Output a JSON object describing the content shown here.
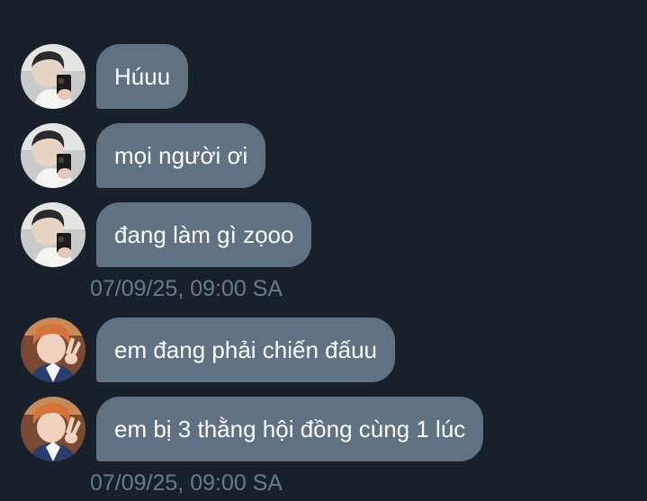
{
  "conversation": {
    "group1": {
      "sender_avatar_icon": "avatar-dark-hair-selfie-icon",
      "messages": [
        {
          "text": "Húuu"
        },
        {
          "text": "mọi người ơi"
        },
        {
          "text": "đang làm gì zọoo"
        }
      ],
      "timestamp": "07/09/25, 09:00 SA"
    },
    "group2": {
      "sender_avatar_icon": "avatar-orange-hair-peace-sign-icon",
      "messages": [
        {
          "text": "em đang phải chiến đấuu"
        },
        {
          "text": "em bị 3 thằng hội đồng cùng 1 lúc"
        }
      ],
      "timestamp": "07/09/25, 09:00 SA"
    }
  },
  "colors": {
    "background": "#18202b",
    "bubble": "#5f7182",
    "bubble_text": "#ffffff",
    "timestamp_text": "#6a7a8b"
  }
}
